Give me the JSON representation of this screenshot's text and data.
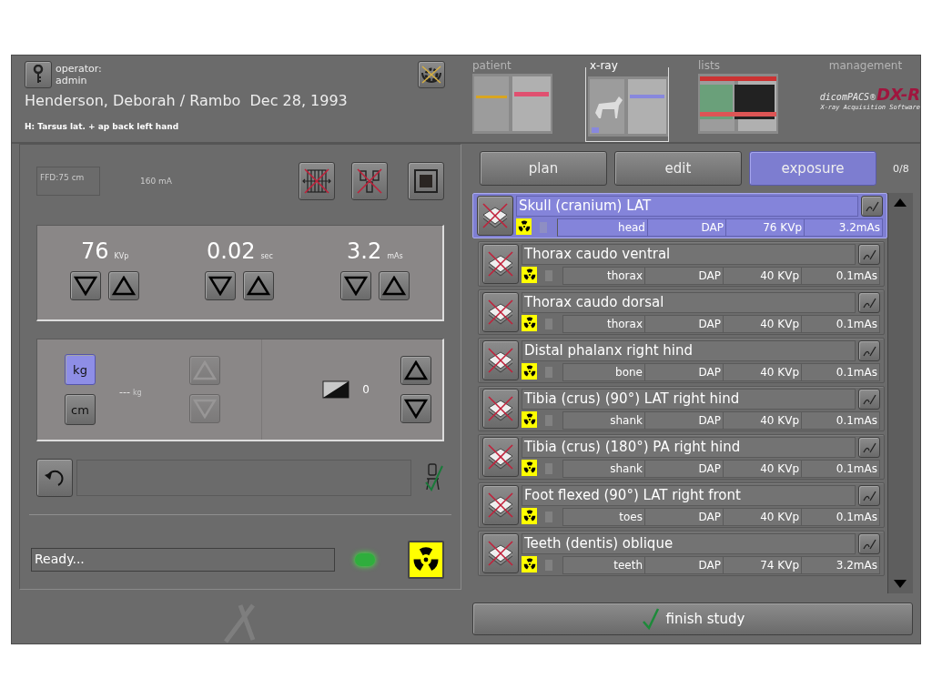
{
  "header": {
    "operator_label": "operator:",
    "operator_name": "admin",
    "patient": "Henderson, Deborah / Rambo  Dec 28, 1993",
    "study": "H: Tarsus lat. + ap back left hand"
  },
  "nav": [
    {
      "label": "patient",
      "kind": "thumbnail",
      "selected": false
    },
    {
      "label": "x-ray",
      "kind": "thumbnail",
      "selected": true
    },
    {
      "label": "lists",
      "kind": "thumbnail",
      "selected": false
    },
    {
      "label": "management",
      "kind": "logo",
      "selected": false
    }
  ],
  "logo": {
    "brand": "dicomPACS",
    "mark": "®",
    "product": "DX-R",
    "tagline": "X-ray Acquisition Software"
  },
  "technique": {
    "ffd": "FFD:75 cm",
    "current": "160 mA",
    "parameters": [
      {
        "value": "76",
        "unit": "KVp"
      },
      {
        "value": "0.02",
        "unit": "sec"
      },
      {
        "value": "3.2",
        "unit": "mAs"
      }
    ]
  },
  "patient_size": {
    "units": [
      {
        "label": "kg",
        "selected": true
      },
      {
        "label": "cm",
        "selected": false
      }
    ],
    "value": "---",
    "unit": "kg",
    "stepper_disabled": true
  },
  "density": {
    "value": "0"
  },
  "status": {
    "text": "Ready...",
    "ready": true
  },
  "tabs": [
    {
      "label": "plan",
      "selected": false
    },
    {
      "label": "edit",
      "selected": false
    },
    {
      "label": "exposure",
      "selected": true
    }
  ],
  "count": "0/8",
  "exams": [
    {
      "title": "Skull (cranium) LAT",
      "selected": true,
      "region": "head",
      "dose": "DAP",
      "kv": "76 KVp",
      "mas": "3.2mAs"
    },
    {
      "title": "Thorax caudo ventral",
      "selected": false,
      "region": "thorax",
      "dose": "DAP",
      "kv": "40 KVp",
      "mas": "0.1mAs"
    },
    {
      "title": "Thorax caudo dorsal",
      "selected": false,
      "region": "thorax",
      "dose": "DAP",
      "kv": "40 KVp",
      "mas": "0.1mAs"
    },
    {
      "title": "Distal phalanx right hind",
      "selected": false,
      "region": "bone",
      "dose": "DAP",
      "kv": "40 KVp",
      "mas": "0.1mAs"
    },
    {
      "title": "Tibia (crus) (90°) LAT right hind",
      "selected": false,
      "region": "shank",
      "dose": "DAP",
      "kv": "40 KVp",
      "mas": "0.1mAs"
    },
    {
      "title": "Tibia (crus) (180°) PA right hind",
      "selected": false,
      "region": "shank",
      "dose": "DAP",
      "kv": "40 KVp",
      "mas": "0.1mAs"
    },
    {
      "title": "Foot flexed (90°) LAT right front",
      "selected": false,
      "region": "toes",
      "dose": "DAP",
      "kv": "40 KVp",
      "mas": "0.1mAs"
    },
    {
      "title": "Teeth (dentis) oblique",
      "selected": false,
      "region": "teeth",
      "dose": "DAP",
      "kv": "74 KVp",
      "mas": "3.2mAs"
    }
  ],
  "finish_button": "finish study"
}
